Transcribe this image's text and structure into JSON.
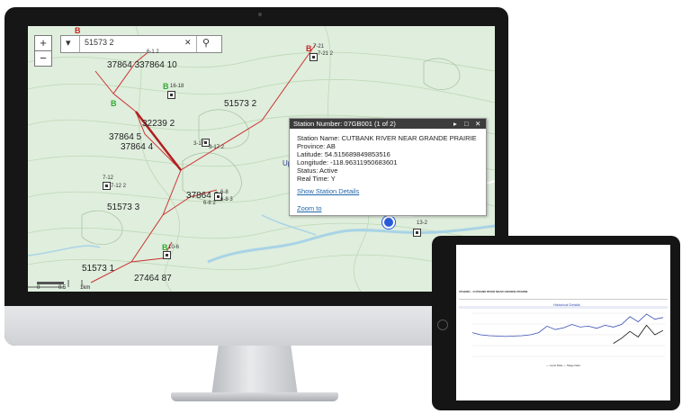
{
  "map": {
    "zoom_in": "+",
    "zoom_out": "−",
    "search_value": "51573 2",
    "clear_glyph": "✕",
    "search_glyph": "⚲",
    "dropdown_glyph": "▾",
    "parcel_labels": [
      "37864 3",
      "37864 10",
      "51573 2",
      "32239 2",
      "37864 5",
      "37864 4",
      "37864 6",
      "51573 3",
      "51573 1",
      "27464 87"
    ],
    "station_labels": [
      "7-21",
      "7-21 2",
      "16-18",
      "3-17",
      "3-17 2",
      "7-12",
      "7-12 2",
      "6-8",
      "6-8 2",
      "6-8 3",
      "13-2",
      "10-6",
      "6-1 2"
    ],
    "marker_letters": [
      "B",
      "B",
      "B",
      "B",
      "B"
    ],
    "station_id_label": "07GB001",
    "partial_label": "Up",
    "scale_labels": [
      "0",
      "0.5",
      "1km"
    ]
  },
  "popup": {
    "title": "Station Number: 07GB001 (1 of 2)",
    "controls": [
      "▸",
      "□",
      "✕"
    ],
    "station_name": "Station Name: CUTBANK RIVER NEAR GRANDE PRAIRIE",
    "province": "Province: AB",
    "latitude": "Latitude: 54.515689849853516",
    "longitude": "Longitude: -118.96311950683601",
    "status": "Status: Active",
    "realtime": "Real Time: Y",
    "details_link": "Show Station Details",
    "zoom_link": "Zoom to"
  },
  "tablet": {
    "header_title": "07GB001 - CUTBANK RIVER NEAR GRANDE PRAIRIE",
    "chart_title": "Historical Details",
    "legend": "— Level Data  — Stage Data"
  },
  "chart_data": {
    "type": "line",
    "title": "Historical Details",
    "xlabel": "",
    "ylabel": "",
    "series": [
      {
        "values": [
          0.55,
          0.5,
          0.48,
          0.47,
          0.46,
          0.47,
          0.48,
          0.5,
          0.55,
          0.7,
          0.62,
          0.66,
          0.74,
          0.68,
          0.7,
          0.65,
          0.72,
          0.68,
          0.74,
          0.92,
          0.8,
          0.98,
          0.86,
          0.9
        ]
      },
      {
        "values": [
          null,
          null,
          null,
          null,
          null,
          null,
          null,
          null,
          null,
          null,
          null,
          null,
          null,
          null,
          null,
          null,
          null,
          0.3,
          0.42,
          0.58,
          0.45,
          0.72,
          0.5,
          0.6
        ]
      }
    ],
    "colors": [
      "#3a4fb5",
      "#111111"
    ],
    "grid": true
  }
}
